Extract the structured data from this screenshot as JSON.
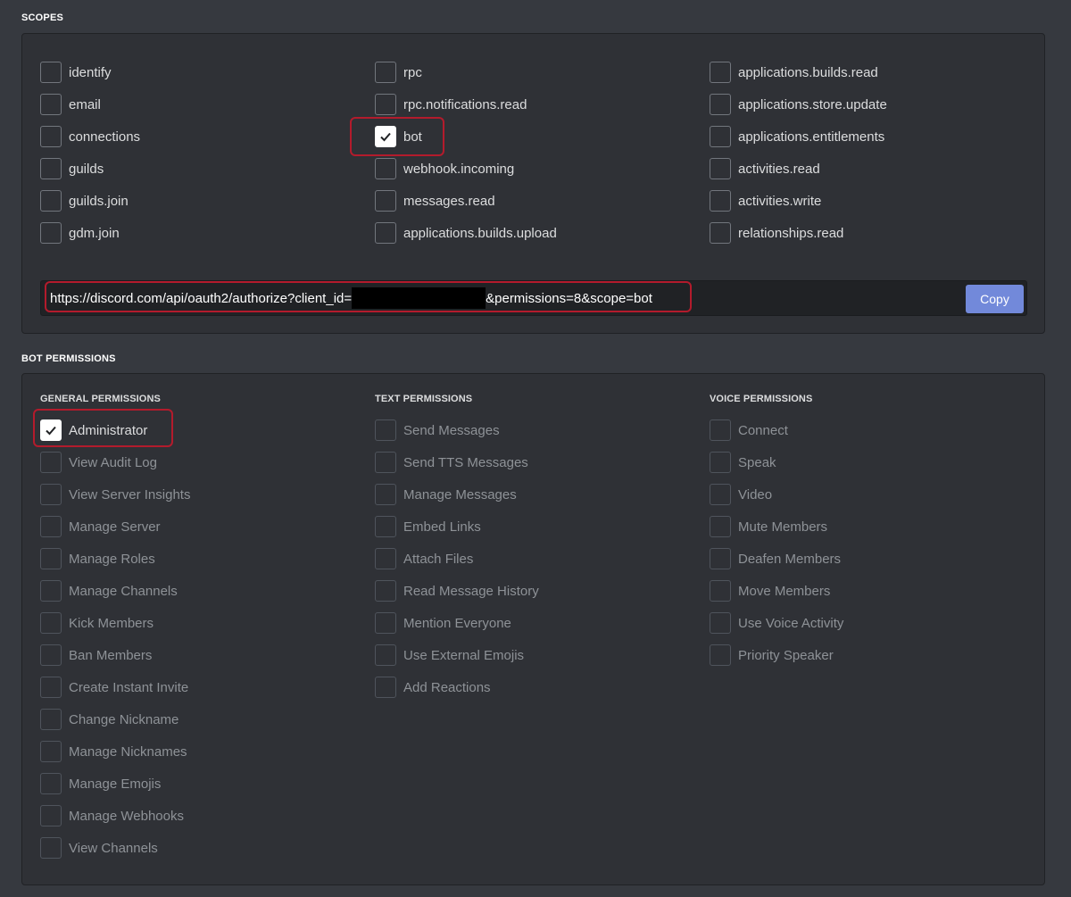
{
  "scopes": {
    "title": "SCOPES",
    "columns": [
      [
        {
          "label": "identify",
          "checked": false
        },
        {
          "label": "email",
          "checked": false
        },
        {
          "label": "connections",
          "checked": false
        },
        {
          "label": "guilds",
          "checked": false
        },
        {
          "label": "guilds.join",
          "checked": false
        },
        {
          "label": "gdm.join",
          "checked": false
        }
      ],
      [
        {
          "label": "rpc",
          "checked": false
        },
        {
          "label": "rpc.notifications.read",
          "checked": false
        },
        {
          "label": "bot",
          "checked": true
        },
        {
          "label": "webhook.incoming",
          "checked": false
        },
        {
          "label": "messages.read",
          "checked": false
        },
        {
          "label": "applications.builds.upload",
          "checked": false
        }
      ],
      [
        {
          "label": "applications.builds.read",
          "checked": false
        },
        {
          "label": "applications.store.update",
          "checked": false
        },
        {
          "label": "applications.entitlements",
          "checked": false
        },
        {
          "label": "activities.read",
          "checked": false
        },
        {
          "label": "activities.write",
          "checked": false
        },
        {
          "label": "relationships.read",
          "checked": false
        }
      ]
    ],
    "url_prefix": "https://discord.com/api/oauth2/authorize?client_id=",
    "url_suffix": "&permissions=8&scope=bot",
    "copy_label": "Copy"
  },
  "bot_permissions": {
    "title": "BOT PERMISSIONS",
    "groups": [
      {
        "title": "GENERAL PERMISSIONS",
        "items": [
          {
            "label": "Administrator",
            "checked": true,
            "disabled": false
          },
          {
            "label": "View Audit Log",
            "checked": false,
            "disabled": true
          },
          {
            "label": "View Server Insights",
            "checked": false,
            "disabled": true
          },
          {
            "label": "Manage Server",
            "checked": false,
            "disabled": true
          },
          {
            "label": "Manage Roles",
            "checked": false,
            "disabled": true
          },
          {
            "label": "Manage Channels",
            "checked": false,
            "disabled": true
          },
          {
            "label": "Kick Members",
            "checked": false,
            "disabled": true
          },
          {
            "label": "Ban Members",
            "checked": false,
            "disabled": true
          },
          {
            "label": "Create Instant Invite",
            "checked": false,
            "disabled": true
          },
          {
            "label": "Change Nickname",
            "checked": false,
            "disabled": true
          },
          {
            "label": "Manage Nicknames",
            "checked": false,
            "disabled": true
          },
          {
            "label": "Manage Emojis",
            "checked": false,
            "disabled": true
          },
          {
            "label": "Manage Webhooks",
            "checked": false,
            "disabled": true
          },
          {
            "label": "View Channels",
            "checked": false,
            "disabled": true
          }
        ]
      },
      {
        "title": "TEXT PERMISSIONS",
        "items": [
          {
            "label": "Send Messages",
            "checked": false,
            "disabled": true
          },
          {
            "label": "Send TTS Messages",
            "checked": false,
            "disabled": true
          },
          {
            "label": "Manage Messages",
            "checked": false,
            "disabled": true
          },
          {
            "label": "Embed Links",
            "checked": false,
            "disabled": true
          },
          {
            "label": "Attach Files",
            "checked": false,
            "disabled": true
          },
          {
            "label": "Read Message History",
            "checked": false,
            "disabled": true
          },
          {
            "label": "Mention Everyone",
            "checked": false,
            "disabled": true
          },
          {
            "label": "Use External Emojis",
            "checked": false,
            "disabled": true
          },
          {
            "label": "Add Reactions",
            "checked": false,
            "disabled": true
          }
        ]
      },
      {
        "title": "VOICE PERMISSIONS",
        "items": [
          {
            "label": "Connect",
            "checked": false,
            "disabled": true
          },
          {
            "label": "Speak",
            "checked": false,
            "disabled": true
          },
          {
            "label": "Video",
            "checked": false,
            "disabled": true
          },
          {
            "label": "Mute Members",
            "checked": false,
            "disabled": true
          },
          {
            "label": "Deafen Members",
            "checked": false,
            "disabled": true
          },
          {
            "label": "Move Members",
            "checked": false,
            "disabled": true
          },
          {
            "label": "Use Voice Activity",
            "checked": false,
            "disabled": true
          },
          {
            "label": "Priority Speaker",
            "checked": false,
            "disabled": true
          }
        ]
      }
    ]
  },
  "colors": {
    "background": "#36393f",
    "panel": "#2f3136",
    "accent": "#7289da",
    "highlight": "#b31b2c"
  }
}
